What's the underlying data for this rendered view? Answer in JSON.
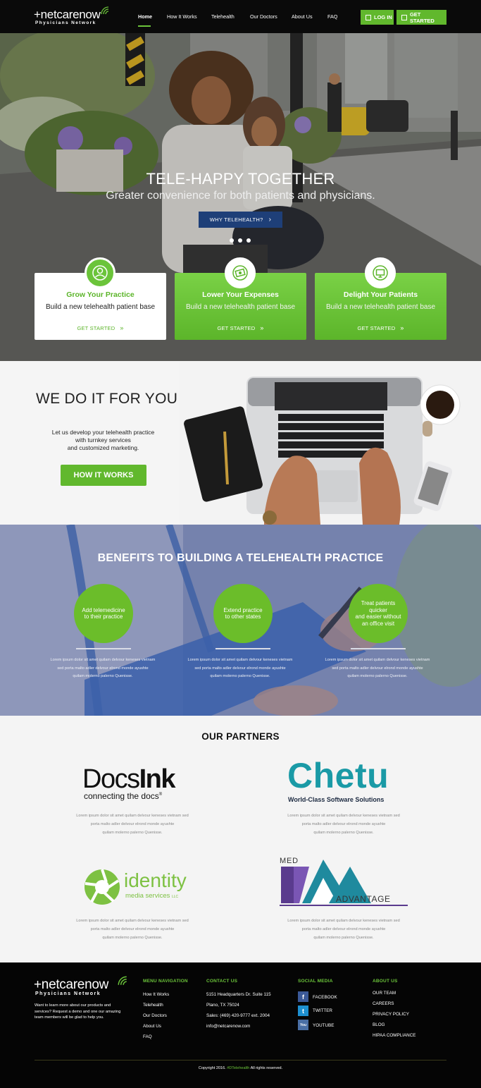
{
  "header": {
    "logo_text": "netcarenow",
    "logo_sub": "Physicians Network",
    "nav": [
      "Home",
      "How It Works",
      "Telehealth",
      "Our Doctors",
      "About Us",
      "FAQ"
    ],
    "login_label": "LOG IN",
    "get_started_label": "GET STARTED"
  },
  "hero": {
    "title": "TELE-HAPPY TOGETHER",
    "subtitle": "Greater convenience for both patients and physicians.",
    "button_label": "WHY TELEHEALTH?",
    "cards": [
      {
        "title": "Grow Your Practice",
        "text": "Build a new telehealth patient base",
        "link": "GET STARTED",
        "icon": "person-icon"
      },
      {
        "title": "Lower Your Expenses",
        "text": "Build a new telehealth patient base",
        "link": "GET STARTED",
        "icon": "money-icon"
      },
      {
        "title": "Delight Your Patients",
        "text": "Build a new telehealth patient base",
        "link": "GET STARTED",
        "icon": "monitor-icon"
      }
    ]
  },
  "wedo": {
    "title": "WE DO IT FOR YOU",
    "text_line1": "Let us develop your telehealth practice",
    "text_line2": "with turnkey services",
    "text_line3": "and customized marketing.",
    "button_label": "HOW IT WORKS"
  },
  "benefits": {
    "title": "BENEFITS TO BUILDING A TELEHEALTH PRACTICE",
    "items": [
      {
        "l1": "Add telemedicine",
        "l2": "to their practice",
        "l3": "",
        "l4": "",
        "t1": "Lorem ipsum dolor sit amet quilam delvour keneses vietnam",
        "t2": "sed porta malto adler delvour elrond monde ayushte",
        "t3": "quilam molerno palerno Quenisse."
      },
      {
        "l1": "Extend practice",
        "l2": "to other states",
        "l3": "",
        "l4": "",
        "t1": "Lorem ipsum dolor sit amet quilam delvour keneses vietnam",
        "t2": "sed porta malto adler delvour elrond monde ayushte",
        "t3": "quilam molerno palerno Quenisse."
      },
      {
        "l1": "Treat patients",
        "l2": "quicker",
        "l3": "and easier without",
        "l4": "an office visit",
        "t1": "Lorem ipsum dolor sit amet quilam delvour keneses vietnam",
        "t2": "sed porta malto adler delvour elrond monde ayushte",
        "t3": "quilam molerno palerno Quenisse."
      }
    ]
  },
  "partners": {
    "title": "OUR PARTNERS",
    "docsink": {
      "name_a": "Docs",
      "name_b": "Ink",
      "tagline": "connecting the docs",
      "reg": "®"
    },
    "chetu": {
      "name": "Chetu",
      "tagline": "World-Class Software Solutions"
    },
    "identity": {
      "name": "identity",
      "tagline": "media services",
      "suffix": "LLC"
    },
    "medadvantage": {
      "top": "MED",
      "bottom": "ADVANTAGE"
    },
    "text": {
      "t1": "Lorem ipsum dolor sit amet quilam delvour keneses vietnam sed",
      "t2": "porta malto adler delvour elrond monde ayushte",
      "t3": "quilam molerno palerno Quenisse."
    }
  },
  "footer": {
    "about": "Want to learn more about our products and services? Request a demo and one our amazing team members will be glad to help you.",
    "menu_heading": "MENU NAVIGATION",
    "menu": [
      "How It Works",
      "Telehealth",
      "Our Doctors",
      "About Us",
      "FAQ"
    ],
    "contact_heading": "CONTACT US",
    "contact": [
      "5151 Headquarters Dr. Suite 115",
      "Plano, TX 75024",
      "Sales: (469) 420-9777 ext. 2004",
      "info@netcarenow.com"
    ],
    "social_heading": "SOCIAL MEDIA",
    "social": [
      "FACEBOOK",
      "TWITTER",
      "YOUTUBE"
    ],
    "about_heading": "ABOUT US",
    "about_links": [
      "OUR TEAM",
      "CAREERS",
      "PRIVACY POLICY",
      "BLOG",
      "HIPAA COMPLIANCE"
    ],
    "copyright_a": "Copyright 2016.",
    "copyright_hl": "#DTelehealth",
    "copyright_b": "All rights reserved."
  },
  "colors": {
    "brand_green": "#61b82d",
    "hero_button": "#1e3f78",
    "facebook": "#3b5998",
    "twitter": "#1da1f2",
    "youtube": "#4a6fa5"
  }
}
